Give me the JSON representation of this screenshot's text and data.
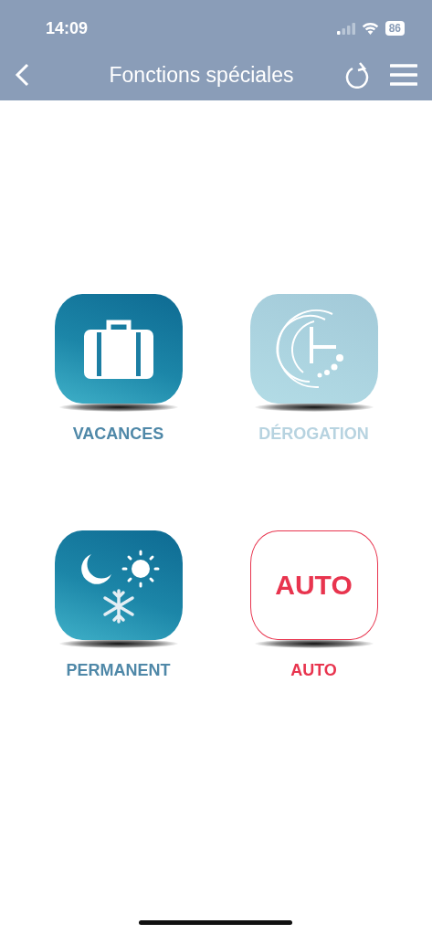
{
  "status_bar": {
    "time": "14:09",
    "battery": "86"
  },
  "header": {
    "title": "Fonctions spéciales"
  },
  "mode_rows": [
    {
      "modes": [
        {
          "kind": "suitcase",
          "label": "VACANCES",
          "disabled": false,
          "selected": false
        },
        {
          "kind": "clock",
          "label": "DÉROGATION",
          "disabled": true,
          "selected": false
        }
      ]
    },
    {
      "modes": [
        {
          "kind": "weather",
          "label": "PERMANENT",
          "disabled": false,
          "selected": false
        },
        {
          "kind": "text",
          "label": "AUTO",
          "tile_text": "AUTO",
          "disabled": false,
          "selected": true
        }
      ]
    }
  ]
}
